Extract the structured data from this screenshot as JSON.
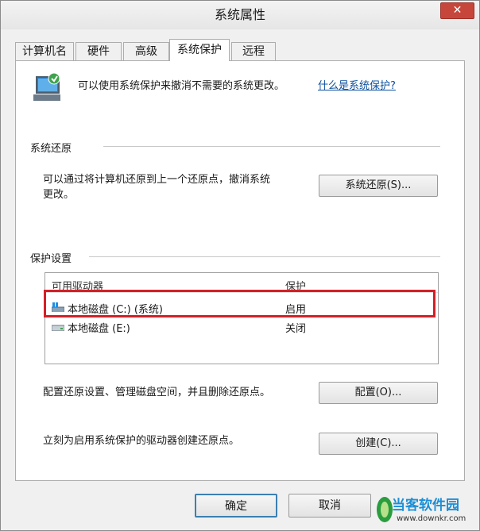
{
  "window": {
    "title": "系统属性",
    "close_label": "✕"
  },
  "tabs": [
    {
      "label": "计算机名"
    },
    {
      "label": "硬件"
    },
    {
      "label": "高级"
    },
    {
      "label": "系统保护"
    },
    {
      "label": "远程"
    }
  ],
  "intro": {
    "text": "可以使用系统保护来撤消不需要的系统更改。",
    "link": "什么是系统保护?"
  },
  "restore": {
    "title": "系统还原",
    "description": "可以通过将计算机还原到上一个还原点，撤消系统\n更改。",
    "button": "系统还原(S)..."
  },
  "protection": {
    "title": "保护设置",
    "columns": [
      "可用驱动器",
      "保护"
    ],
    "drives": [
      {
        "name": "本地磁盘 (C:) (系统)",
        "status": "启用",
        "icon": "system-drive-icon"
      },
      {
        "name": "本地磁盘 (E:)",
        "status": "关闭",
        "icon": "drive-icon"
      }
    ],
    "configure_text": "配置还原设置、管理磁盘空间，并且删除还原点。",
    "configure_button": "配置(O)...",
    "create_text": "立刻为启用系统保护的驱动器创建还原点。",
    "create_button": "创建(C)..."
  },
  "footer": {
    "ok": "确定",
    "cancel": "取消"
  },
  "watermark": {
    "title": "当客软件园",
    "url": "www.downkr.com"
  },
  "colors": {
    "link": "#0b4f9e",
    "highlight": "#d51f26",
    "close": "#c7463b",
    "watermark": "#1c8fd6"
  }
}
